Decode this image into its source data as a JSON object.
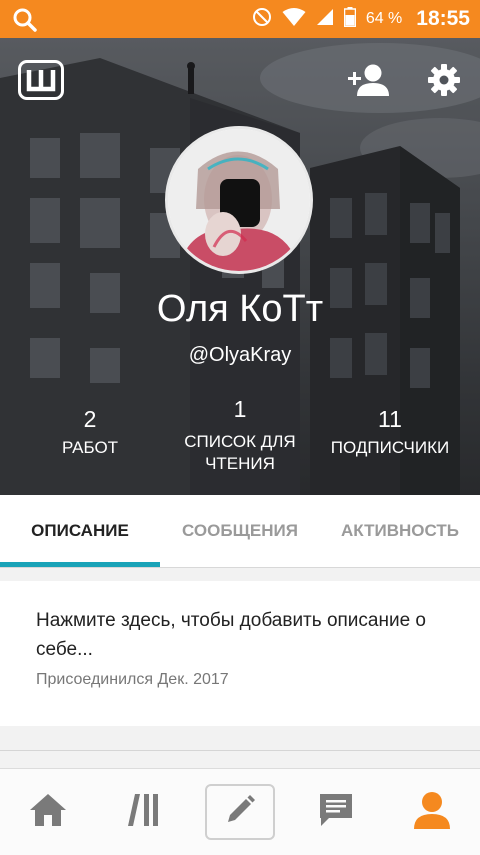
{
  "status_bar": {
    "battery_percent": "64 %",
    "time": "18:55",
    "icons": [
      "search-icon",
      "do-not-disturb-icon",
      "wifi-icon",
      "signal-icon",
      "battery-icon"
    ]
  },
  "header": {
    "logo_icon": "wattpad-w-logo",
    "actions": [
      "add-user-icon",
      "gear-icon"
    ]
  },
  "profile": {
    "name": "Оля КоТт",
    "username": "@OlyaKray",
    "stats": [
      {
        "value": "2",
        "label": "РАБОТ"
      },
      {
        "value": "1",
        "label": "СПИСОК ДЛЯ ЧТЕНИЯ"
      },
      {
        "value": "11",
        "label": "ПОДПИСЧИКИ"
      }
    ]
  },
  "tabs": {
    "items": [
      {
        "label": "ОПИСАНИЕ",
        "active": true
      },
      {
        "label": "СООБЩЕНИЯ",
        "active": false
      },
      {
        "label": "АКТИВНОСТЬ",
        "active": false
      }
    ],
    "indicator_color": "#1aa3b8"
  },
  "about": {
    "description_prompt": "Нажмите здесь, чтобы добавить описание о себе...",
    "joined": "Присоединился Дек. 2017"
  },
  "bottom_nav": {
    "items": [
      "home-icon",
      "library-icon",
      "write-icon",
      "messages-icon",
      "profile-icon"
    ],
    "active": "profile-icon",
    "active_color": "#f5891f"
  },
  "colors": {
    "status_bar": "#f5891f",
    "accent": "#f5891f"
  }
}
